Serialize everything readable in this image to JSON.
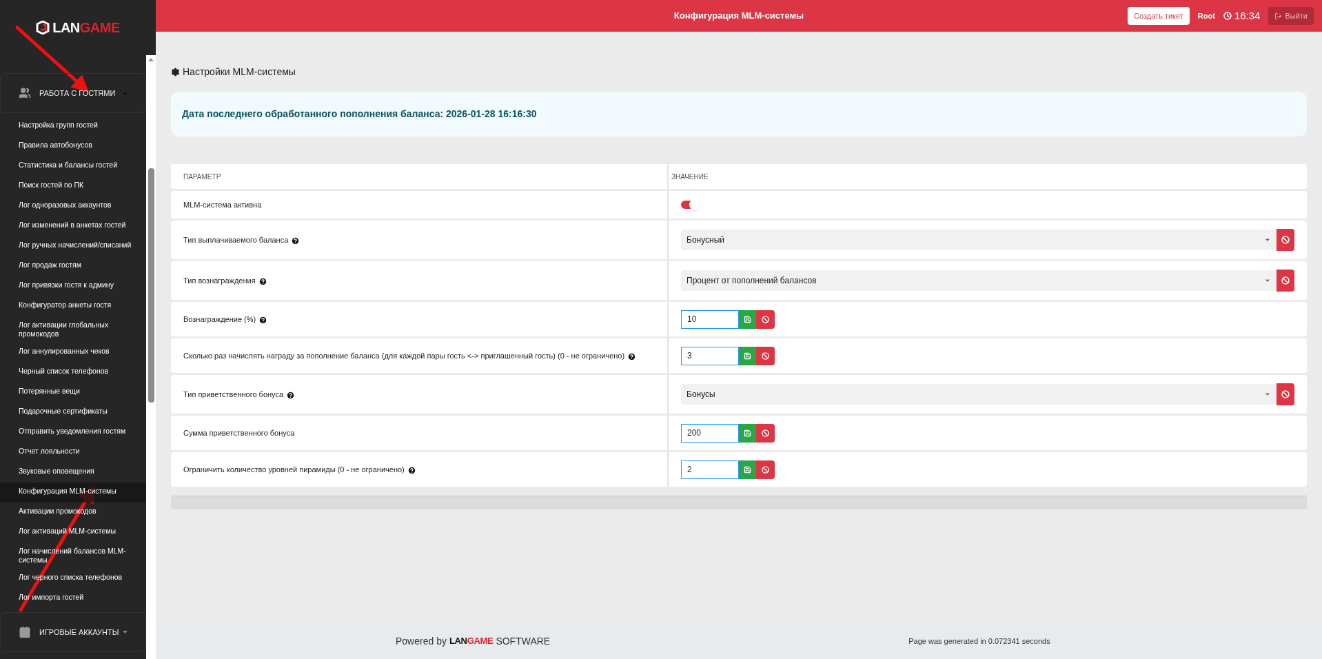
{
  "logo": {
    "light": "LAN",
    "accent": "GAME"
  },
  "sidebar": {
    "groups": [
      {
        "label": "РАБОТА С ГОСТЯМИ",
        "expanded": true,
        "items": [
          {
            "label": "Настройка групп гостей",
            "selected": false
          },
          {
            "label": "Правила автобонусов",
            "selected": false
          },
          {
            "label": "Статистика и балансы гостей",
            "selected": false
          },
          {
            "label": "Поиск гостей по ПК",
            "selected": false
          },
          {
            "label": "Лог одноразовых аккаунтов",
            "selected": false
          },
          {
            "label": "Лог изменений в анкетах гостей",
            "selected": false
          },
          {
            "label": "Лог ручных начислений/списаний",
            "selected": false
          },
          {
            "label": "Лог продаж гостям",
            "selected": false
          },
          {
            "label": "Лог привязки гостя к админу",
            "selected": false
          },
          {
            "label": "Конфигуратор анкеты гостя",
            "selected": false
          },
          {
            "label": "Лог активации глобальных промокодов",
            "selected": false
          },
          {
            "label": "Лог аннулированных чеков",
            "selected": false
          },
          {
            "label": "Черный список телефонов",
            "selected": false
          },
          {
            "label": "Потерянные вещи",
            "selected": false
          },
          {
            "label": "Подарочные сертификаты",
            "selected": false
          },
          {
            "label": "Отправить уведомления гостям",
            "selected": false
          },
          {
            "label": "Отчет лояльности",
            "selected": false
          },
          {
            "label": "Звуковые оповещения",
            "selected": false
          },
          {
            "label": "Конфигурация MLM-системы",
            "selected": true
          },
          {
            "label": "Активации промокодов",
            "selected": false
          },
          {
            "label": "Лог активаций MLM-системы",
            "selected": false
          },
          {
            "label": "Лог начислений балансов MLM-системы",
            "selected": false
          },
          {
            "label": "Лог черного списка телефонов",
            "selected": false
          },
          {
            "label": "Лог импорта гостей",
            "selected": false
          }
        ]
      },
      {
        "label": "ИГРОВЫЕ АККАУНТЫ",
        "expanded": false
      }
    ]
  },
  "header": {
    "title": "Конфигурация MLM-системы",
    "ticket_button": "Создать тикет",
    "user": "Root",
    "time": "16:34",
    "logout_button": "Выйти"
  },
  "page_title": "Настройки MLM-системы",
  "info": "Дата последнего обработанного пополнения баланса: 2026-01-28 16:16:30",
  "table": {
    "columns": [
      "ПАРАМЕТР",
      "ЗНАЧЕНИЕ"
    ],
    "rows": [
      {
        "label": "MLM-система активна",
        "help": false,
        "kind": "toggle",
        "on": true
      },
      {
        "label": "Тип выплачиваемого баланса",
        "help": true,
        "kind": "select",
        "value": "Бонусный"
      },
      {
        "label": "Тип вознаграждения",
        "help": true,
        "kind": "select",
        "value": "Процент от пополнений балансов"
      },
      {
        "label": "Вознаграждение (%)",
        "help": true,
        "kind": "number",
        "value": "10"
      },
      {
        "label": "Сколько раз начислять награду за пополнение баланса (для каждой пары гость <-> приглашенный гость) (0 - не ограничено)",
        "help": true,
        "kind": "number",
        "value": "3"
      },
      {
        "label": "Тип приветственного бонуса",
        "help": true,
        "kind": "select",
        "value": "Бонусы"
      },
      {
        "label": "Сумма приветственного бонуса",
        "help": false,
        "kind": "number",
        "value": "200"
      },
      {
        "label": "Ограничить количество уровней пирамиды (0 - не ограничено)",
        "help": true,
        "kind": "number",
        "value": "2"
      }
    ]
  },
  "footer": {
    "powered": "Powered by",
    "logo": {
      "light": "LAN",
      "accent": "GAME"
    },
    "software": "SOFTWARE",
    "generated": "Page was generated in 0.072341 seconds"
  }
}
